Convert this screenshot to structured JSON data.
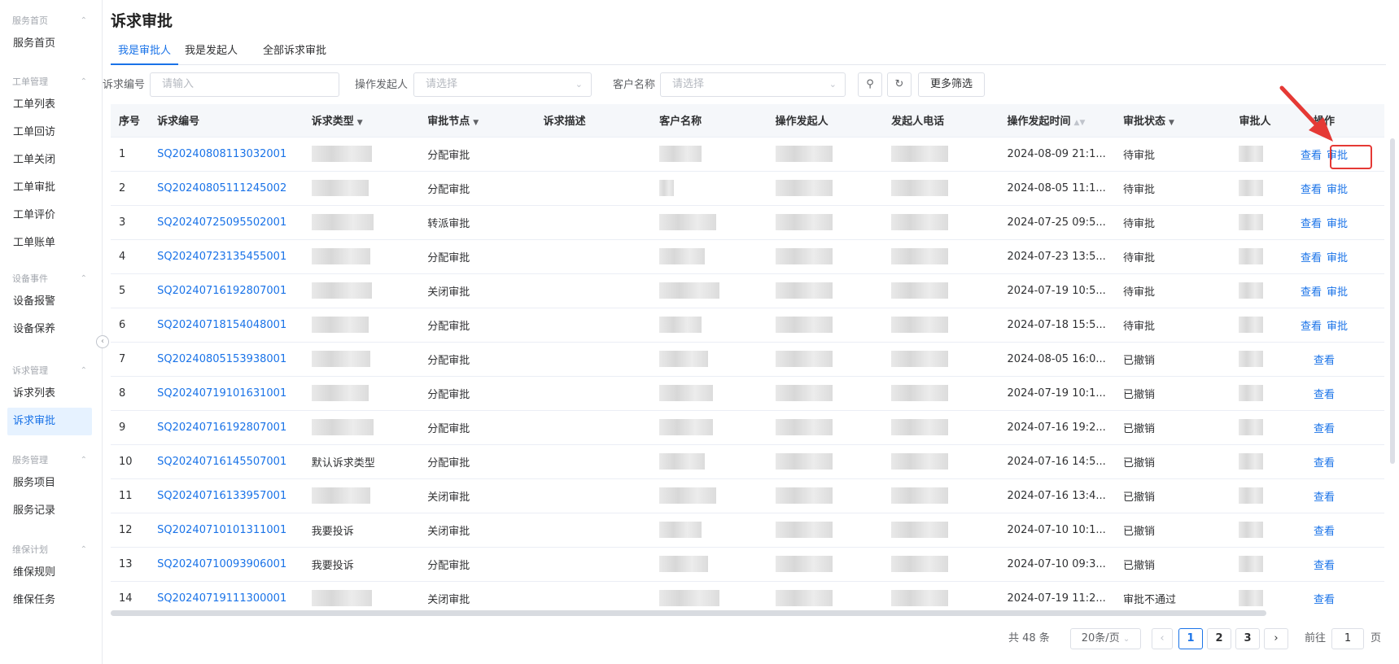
{
  "sidebar": {
    "groups": [
      {
        "title": "服务首页",
        "items": [
          "服务首页"
        ]
      },
      {
        "title": "工单管理",
        "items": [
          "工单列表",
          "工单回访",
          "工单关闭",
          "工单审批",
          "工单评价",
          "工单账单"
        ]
      },
      {
        "title": "设备事件",
        "items": [
          "设备报警",
          "设备保养"
        ]
      },
      {
        "title": "诉求管理",
        "items": [
          "诉求列表",
          "诉求审批"
        ]
      },
      {
        "title": "服务管理",
        "items": [
          "服务项目",
          "服务记录"
        ]
      },
      {
        "title": "维保计划",
        "items": [
          "维保规则",
          "维保任务"
        ]
      }
    ],
    "active_item": "诉求审批"
  },
  "page": {
    "title": "诉求审批"
  },
  "tabs": [
    "我是审批人",
    "我是发起人",
    "全部诉求审批"
  ],
  "active_tab": "我是审批人",
  "filters": {
    "code_label": "诉求编号",
    "code_placeholder": "请输入",
    "initiator_label": "操作发起人",
    "initiator_placeholder": "请选择",
    "customer_label": "客户名称",
    "customer_placeholder": "请选择",
    "more_label": "更多筛选"
  },
  "table": {
    "columns": [
      "序号",
      "诉求编号",
      "诉求类型",
      "审批节点",
      "诉求描述",
      "客户名称",
      "操作发起人",
      "发起人电话",
      "操作发起时间",
      "审批状态",
      "审批人",
      "操作"
    ],
    "rows": [
      {
        "no": "1",
        "code": "SQ20240808113032001",
        "type": "",
        "node": "分配审批",
        "time": "2024-08-09 21:1...",
        "status": "待审批",
        "actions": [
          "查看",
          "审批"
        ]
      },
      {
        "no": "2",
        "code": "SQ20240805111245002",
        "type": "",
        "node": "分配审批",
        "time": "2024-08-05 11:1...",
        "status": "待审批",
        "actions": [
          "查看",
          "审批"
        ]
      },
      {
        "no": "3",
        "code": "SQ20240725095502001",
        "type": "",
        "node": "转派审批",
        "time": "2024-07-25 09:5...",
        "status": "待审批",
        "actions": [
          "查看",
          "审批"
        ]
      },
      {
        "no": "4",
        "code": "SQ20240723135455001",
        "type": "",
        "node": "分配审批",
        "time": "2024-07-23 13:5...",
        "status": "待审批",
        "actions": [
          "查看",
          "审批"
        ]
      },
      {
        "no": "5",
        "code": "SQ20240716192807001",
        "type": "",
        "node": "关闭审批",
        "time": "2024-07-19 10:5...",
        "status": "待审批",
        "actions": [
          "查看",
          "审批"
        ]
      },
      {
        "no": "6",
        "code": "SQ20240718154048001",
        "type": "",
        "node": "分配审批",
        "time": "2024-07-18 15:5...",
        "status": "待审批",
        "actions": [
          "查看",
          "审批"
        ]
      },
      {
        "no": "7",
        "code": "SQ20240805153938001",
        "type": "",
        "node": "分配审批",
        "time": "2024-08-05 16:0...",
        "status": "已撤销",
        "actions": [
          "查看"
        ]
      },
      {
        "no": "8",
        "code": "SQ20240719101631001",
        "type": "",
        "node": "分配审批",
        "time": "2024-07-19 10:1...",
        "status": "已撤销",
        "actions": [
          "查看"
        ]
      },
      {
        "no": "9",
        "code": "SQ20240716192807001",
        "type": "",
        "node": "分配审批",
        "time": "2024-07-16 19:2...",
        "status": "已撤销",
        "actions": [
          "查看"
        ]
      },
      {
        "no": "10",
        "code": "SQ20240716145507001",
        "type": "默认诉求类型",
        "node": "分配审批",
        "time": "2024-07-16 14:5...",
        "status": "已撤销",
        "actions": [
          "查看"
        ]
      },
      {
        "no": "11",
        "code": "SQ20240716133957001",
        "type": "",
        "node": "关闭审批",
        "time": "2024-07-16 13:4...",
        "status": "已撤销",
        "actions": [
          "查看"
        ]
      },
      {
        "no": "12",
        "code": "SQ20240710101311001",
        "type": "我要投诉",
        "node": "关闭审批",
        "time": "2024-07-10 10:1...",
        "status": "已撤销",
        "actions": [
          "查看"
        ]
      },
      {
        "no": "13",
        "code": "SQ20240710093906001",
        "type": "我要投诉",
        "node": "分配审批",
        "time": "2024-07-10 09:3...",
        "status": "已撤销",
        "actions": [
          "查看"
        ]
      },
      {
        "no": "14",
        "code": "SQ20240719111300001",
        "type": "",
        "node": "关闭审批",
        "time": "2024-07-19 11:2...",
        "status": "审批不通过",
        "actions": [
          "查看"
        ]
      }
    ]
  },
  "pagination": {
    "total_text": "共 48 条",
    "page_size": "20条/页",
    "pages": [
      "1",
      "2",
      "3"
    ],
    "current_page": "1",
    "goto_label": "前往",
    "goto_value": "1",
    "goto_suffix": "页"
  },
  "colors": {
    "accent": "#1a73e8",
    "annotation": "#e53935"
  },
  "icons": [
    "search-icon",
    "refresh-icon",
    "collapse-icon",
    "prev-page-icon",
    "next-page-icon",
    "chevron-down-icon",
    "filter-icon",
    "sort-icon",
    "annotation-arrow-icon"
  ]
}
